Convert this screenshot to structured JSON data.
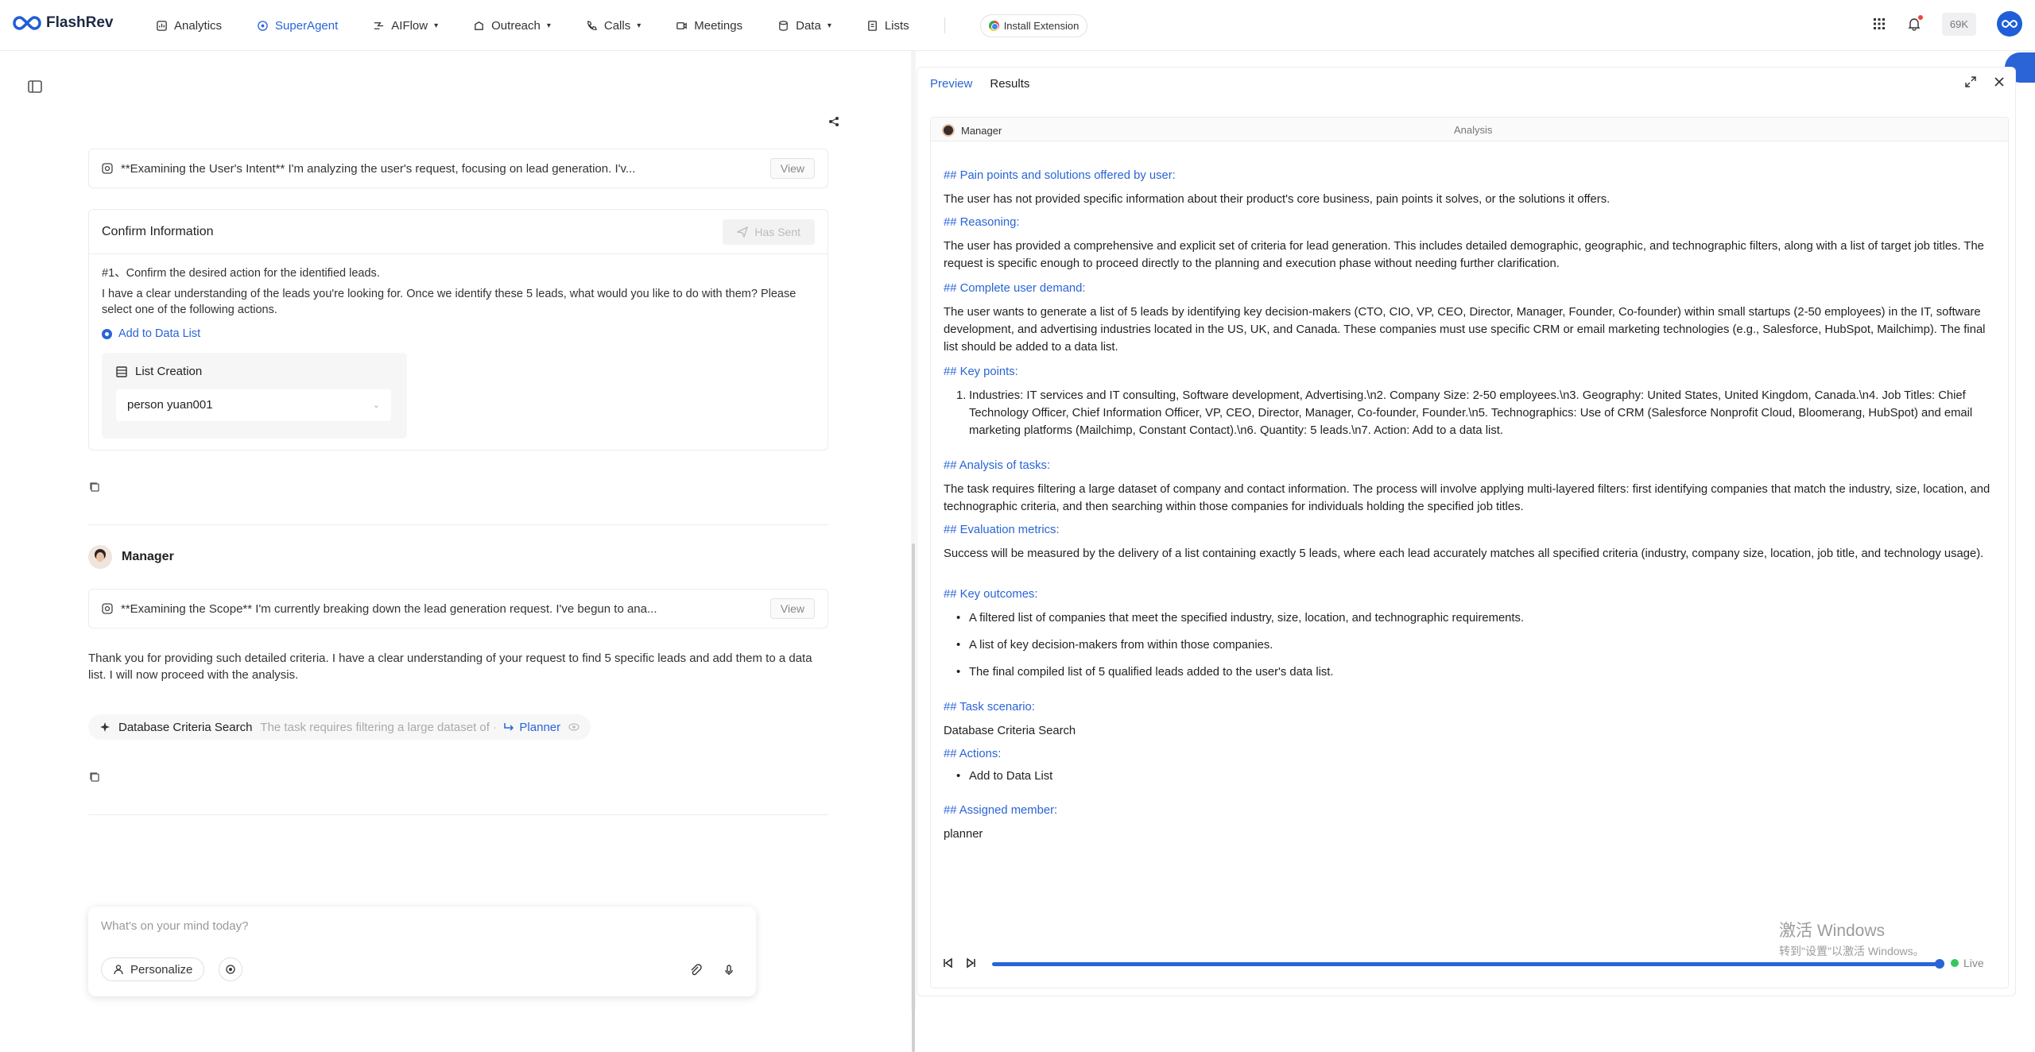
{
  "brand": "FlashRev",
  "nav": [
    {
      "label": "Analytics",
      "icon": "analytics-icon"
    },
    {
      "label": "SuperAgent",
      "icon": "superagent-icon"
    },
    {
      "label": "AIFlow",
      "icon": "aiflow-icon"
    },
    {
      "label": "Outreach",
      "icon": "outreach-icon"
    },
    {
      "label": "Calls",
      "icon": "calls-icon"
    },
    {
      "label": "Meetings",
      "icon": "meetings-icon"
    },
    {
      "label": "Data",
      "icon": "data-icon"
    },
    {
      "label": "Lists",
      "icon": "lists-icon"
    }
  ],
  "install_extension": "Install Extension",
  "credits": "69K",
  "user_initials": "ᔑ",
  "chat": {
    "thinking1": "**Examining the User's Intent** I'm analyzing the user's request, focusing on lead generation. I'v...",
    "view_label": "View",
    "confirm": {
      "title": "Confirm Information",
      "sent_label": "Has Sent",
      "question": "#1、Confirm the desired action for the identified leads.",
      "body": "I have a clear understanding of the leads you're looking for. Once we identify these 5 leads, what would you like to do with them? Please select one of the following actions.",
      "option": "Add to Data List",
      "list_title": "List Creation",
      "list_value": "person yuan001"
    },
    "manager_name": "Manager",
    "thinking2": "**Examining the Scope** I'm currently breaking down the lead generation request. I've begun to ana...",
    "reply": "Thank you for providing such detailed criteria. I have a clear understanding of your request to find 5 specific leads and add them to a data list. I will now proceed with the analysis.",
    "task": {
      "name": "Database Criteria Search",
      "desc": "The task requires filtering a large dataset of ···",
      "agent": "Planner"
    },
    "composer_placeholder": "What's on your mind today?",
    "personalize": "Personalize"
  },
  "panel": {
    "tabs": [
      "Preview",
      "Results"
    ],
    "author": "Manager",
    "header_label": "Analysis",
    "sections": {
      "pain_h": "## Pain points and solutions offered by user:",
      "pain": "The user has not provided specific information about their product's core business, pain points it solves, or the solutions it offers.",
      "reason_h": "## Reasoning:",
      "reason": "The user has provided a comprehensive and explicit set of criteria for lead generation. This includes detailed demographic, geographic, and technographic filters, along with a list of target job titles. The request is specific enough to proceed directly to the planning and execution phase without needing further clarification.",
      "demand_h": "## Complete user demand:",
      "demand": "The user wants to generate a list of 5 leads by identifying key decision-makers (CTO, CIO, VP, CEO, Director, Manager, Founder, Co-founder) within small startups (2-50 employees) in the IT, software development, and advertising industries located in the US, UK, and Canada. These companies must use specific CRM or email marketing technologies (e.g., Salesforce, HubSpot, Mailchimp). The final list should be added to a data list.",
      "key_h": "## Key points:",
      "key_num": "1.",
      "key": "Industries: IT services and IT consulting, Software development, Advertising.\\n2. Company Size: 2-50 employees.\\n3. Geography: United States, United Kingdom, Canada.\\n4. Job Titles: Chief Technology Officer, Chief Information Officer, VP, CEO, Director, Manager, Co-founder, Founder.\\n5. Technographics: Use of CRM (Salesforce Nonprofit Cloud, Bloomerang, HubSpot) and email marketing platforms (Mailchimp, Constant Contact).\\n6. Quantity: 5 leads.\\n7. Action: Add to a data list.",
      "analysis_h": "## Analysis of tasks:",
      "analysis": "The task requires filtering a large dataset of company and contact information. The process will involve applying multi-layered filters: first identifying companies that match the industry, size, location, and technographic criteria, and then searching within those companies for individuals holding the specified job titles.",
      "eval_h": "## Evaluation metrics:",
      "eval": "Success will be measured by the delivery of a list containing exactly 5 leads, where each lead accurately matches all specified criteria (industry, company size, location, job title, and technology usage).",
      "outcomes_h": "## Key outcomes:",
      "outcomes": [
        "A filtered list of companies that meet the specified industry, size, location, and technographic requirements.",
        "A list of key decision-makers from within those companies.",
        "The final compiled list of 5 qualified leads added to the user's data list."
      ],
      "scenario_h": "## Task scenario:",
      "scenario": "Database Criteria Search",
      "actions_h": "## Actions:",
      "actions": [
        "Add to Data List"
      ],
      "member_h": "## Assigned member:",
      "member": "planner"
    },
    "live_label": "Live",
    "progress": 1.0
  },
  "watermark": {
    "line1": "激活 Windows",
    "line2": "转到\"设置\"以激活 Windows。"
  },
  "colors": {
    "accent": "#2a64d6",
    "live": "#34c759"
  }
}
